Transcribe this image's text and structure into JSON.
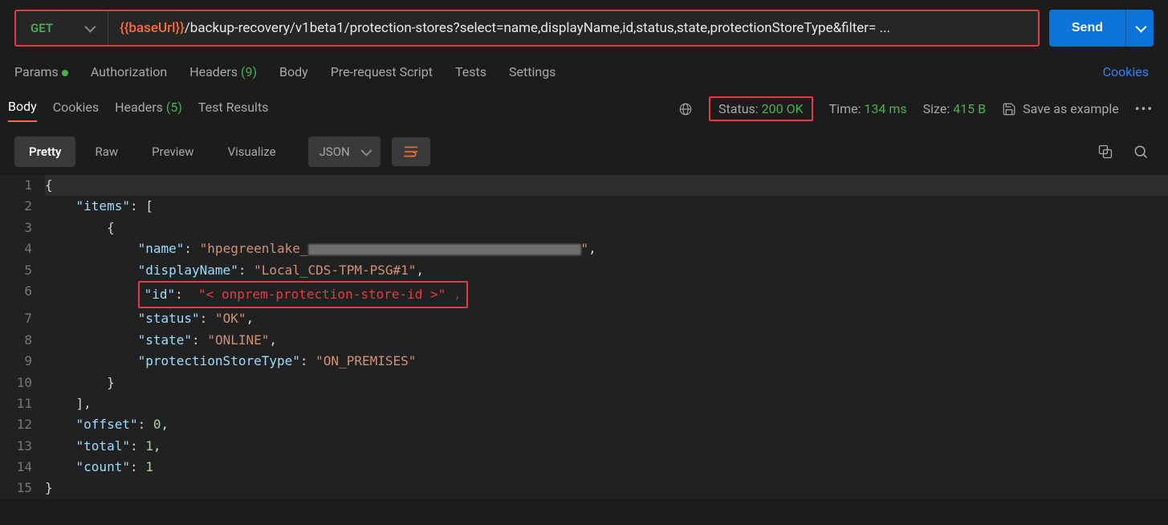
{
  "request": {
    "method": "GET",
    "baseUrlVar": "{{baseUrl}}",
    "path": "/backup-recovery/v1beta1/protection-stores?select=name,displayName,id,status,state,protectionStoreType&filter= ...",
    "send_label": "Send"
  },
  "reqTabs": {
    "params": "Params",
    "authorization": "Authorization",
    "headers": "Headers",
    "headersCount": "(9)",
    "body": "Body",
    "prerequest": "Pre-request Script",
    "tests": "Tests",
    "settings": "Settings",
    "cookies": "Cookies"
  },
  "respTabs": {
    "body": "Body",
    "cookies": "Cookies",
    "headers": "Headers",
    "headersCount": "(5)",
    "testResults": "Test Results"
  },
  "respMeta": {
    "statusLabel": "Status:",
    "statusValue": "200 OK",
    "timeLabel": "Time:",
    "timeValue": "134 ms",
    "sizeLabel": "Size:",
    "sizeValue": "415 B",
    "saveExample": "Save as example"
  },
  "viewTabs": {
    "pretty": "Pretty",
    "raw": "Raw",
    "preview": "Preview",
    "visualize": "Visualize",
    "format": "JSON"
  },
  "json": {
    "namePrefix": "hpegreenlake_",
    "displayName": "Local_CDS-TPM-PSG#1",
    "idPlaceholder": "< onprem-protection-store-id >",
    "status": "OK",
    "state": "ONLINE",
    "protectionStoreType": "ON_PREMISES",
    "offset": "0",
    "total": "1",
    "count": "1"
  },
  "lineNumbers": [
    "1",
    "2",
    "3",
    "4",
    "5",
    "6",
    "7",
    "8",
    "9",
    "10",
    "11",
    "12",
    "13",
    "14",
    "15"
  ]
}
